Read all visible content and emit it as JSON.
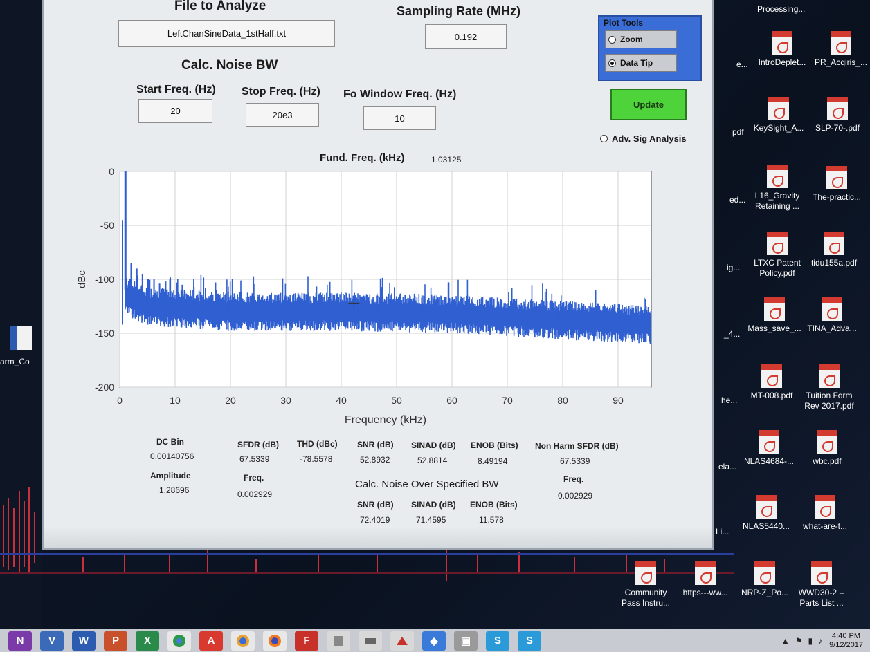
{
  "app": {
    "file_label": "File to Analyze",
    "file_value": "LeftChanSineData_1stHalf.txt",
    "sampling_label": "Sampling Rate (MHz)",
    "sampling_value": "0.192",
    "noise_bw_title": "Calc. Noise BW",
    "start_label": "Start Freq. (Hz)",
    "start_value": "20",
    "stop_label": "Stop Freq. (Hz)",
    "stop_value": "20e3",
    "fo_label": "Fo Window Freq. (Hz)",
    "fo_value": "10",
    "plot_tools_title": "Plot Tools",
    "zoom_label": "Zoom",
    "datatip_label": "Data Tip",
    "update_label": "Update",
    "adv_label": "Adv. Sig Analysis",
    "fund_label": "Fund. Freq. (kHz)",
    "fund_value": "1.03125"
  },
  "stats": {
    "dc_bin_label": "DC Bin",
    "dc_bin_value": "0.00140756",
    "amplitude_label": "Amplitude",
    "amplitude_value": "1.28696",
    "sfdr_label": "SFDR (dB)",
    "sfdr_value": "67.5339",
    "freq_label": "Freq.",
    "sfdr_freq_value": "0.002929",
    "thd_label": "THD (dBc)",
    "thd_value": "-78.5578",
    "snr_label": "SNR (dB)",
    "snr_value": "52.8932",
    "sinad_label": "SINAD (dB)",
    "sinad_value": "52.8814",
    "enob_label": "ENOB (Bits)",
    "enob_value": "8.49194",
    "nh_sfdr_label": "Non Harm SFDR (dB)",
    "nh_sfdr_value": "67.5339",
    "nh_freq_label": "Freq.",
    "nh_freq_value": "0.002929",
    "noise_bw_heading": "Calc. Noise Over Specified BW",
    "bw_snr_label": "SNR (dB)",
    "bw_snr_value": "72.4019",
    "bw_sinad_label": "SINAD (dB)",
    "bw_sinad_value": "71.4595",
    "bw_enob_label": "ENOB (Bits)",
    "bw_enob_value": "11.578"
  },
  "chart_data": {
    "type": "line",
    "xlabel": "Frequency (kHz)",
    "ylabel": "dBc",
    "xlim": [
      0,
      96
    ],
    "ylim": [
      -200,
      0
    ],
    "xticks": [
      0,
      10,
      20,
      30,
      40,
      50,
      60,
      70,
      80,
      90
    ],
    "yticks": [
      0,
      -50,
      -100,
      -150,
      -200
    ],
    "grid": true,
    "series": [
      {
        "color": "#2f5fd0",
        "fundamental": {
          "x": 1.03125,
          "y": 0
        },
        "noise_floor": [
          [
            1,
            -115
          ],
          [
            5,
            -125
          ],
          [
            20,
            -130
          ],
          [
            40,
            -130
          ],
          [
            60,
            -132
          ],
          [
            80,
            -138
          ],
          [
            96,
            -142
          ]
        ],
        "spurs": [
          [
            0.5,
            -45
          ],
          [
            2.06,
            -85
          ],
          [
            3.09,
            -90
          ],
          [
            4.1,
            -95
          ],
          [
            5.2,
            -100
          ],
          [
            6.2,
            -100
          ],
          [
            7.2,
            -104
          ],
          [
            8.3,
            -102
          ],
          [
            10.3,
            -103
          ],
          [
            11.3,
            -105
          ],
          [
            13.4,
            -107
          ],
          [
            15.5,
            -108
          ],
          [
            17.5,
            -110
          ],
          [
            19.6,
            -112
          ],
          [
            21.7,
            -112
          ],
          [
            25.8,
            -115
          ],
          [
            29.9,
            -115
          ],
          [
            34.0,
            -118
          ],
          [
            38.1,
            -118
          ],
          [
            42.3,
            -115
          ],
          [
            46.4,
            -115
          ],
          [
            50.5,
            -114
          ],
          [
            54.6,
            -115
          ],
          [
            62.8,
            -115
          ],
          [
            66.9,
            -117
          ],
          [
            71.1,
            -118
          ],
          [
            75.2,
            -122
          ],
          [
            79.3,
            -125
          ],
          [
            83.4,
            -128
          ]
        ]
      }
    ]
  },
  "desktop": {
    "processing_label": "Processing...",
    "icons": [
      {
        "label": "IntroDeplet..."
      },
      {
        "label": "PR_Acqiris_..."
      },
      {
        "label": "KeySight_A..."
      },
      {
        "label": "SLP-70-.pdf"
      },
      {
        "label": "L16_Gravity Retaining ..."
      },
      {
        "label": "The-practic..."
      },
      {
        "label": "LTXC Patent Policy.pdf"
      },
      {
        "label": "tidu155a.pdf"
      },
      {
        "label": "Mass_save_..."
      },
      {
        "label": "TINA_Adva..."
      },
      {
        "label": "MT-008.pdf"
      },
      {
        "label": "Tuition Form Rev 2017.pdf"
      },
      {
        "label": "NLAS4684-..."
      },
      {
        "label": "wbc.pdf"
      },
      {
        "label": "NLAS5440..."
      },
      {
        "label": "what-are-t..."
      },
      {
        "label": "Community Pass Instru..."
      },
      {
        "label": "https---ww..."
      },
      {
        "label": "NRP-Z_Po..."
      },
      {
        "label": "WWD30-2 -- Parts List ..."
      }
    ],
    "partial_labels": [
      "e...",
      "pdf",
      "ed...",
      "ig...",
      "_4...",
      "he...",
      "ela...",
      "Li...",
      "arm_Co"
    ]
  },
  "taskbar": {
    "time": "4:40 PM",
    "date": "9/12/2017"
  }
}
